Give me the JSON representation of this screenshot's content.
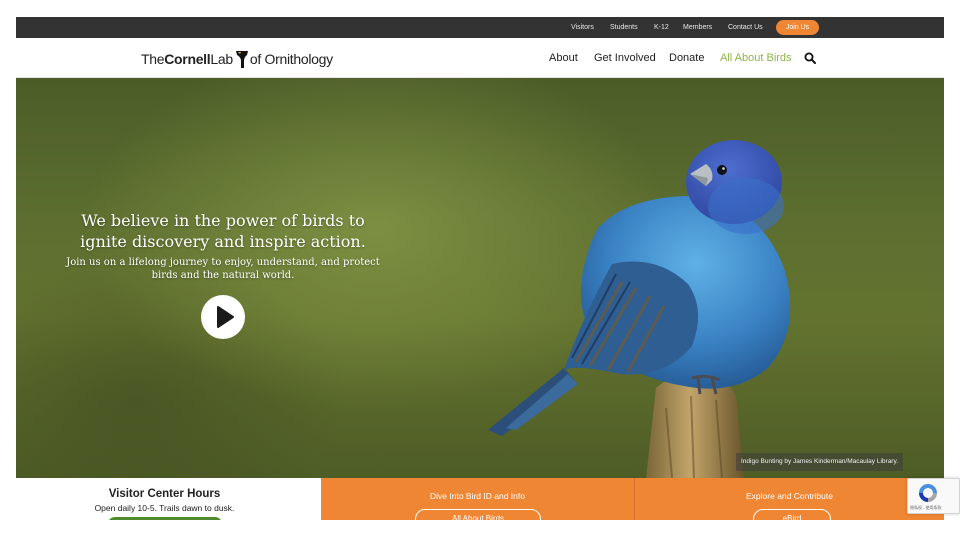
{
  "utility_bar": {
    "links": [
      "Visitors",
      "Students",
      "K-12",
      "Members",
      "Contact Us"
    ],
    "join_label": "Join Us"
  },
  "logo": {
    "the": "The",
    "cornell": "Cornell",
    "lab": "Lab",
    "ornithology": "of Ornithology"
  },
  "nav": {
    "items": [
      "About",
      "Get Involved",
      "Donate",
      "All About Birds"
    ],
    "active_item": "All About Birds",
    "search_icon": "search-icon"
  },
  "hero": {
    "heading": "We believe in the power of birds to ignite discovery and inspire action.",
    "subheading": "Join us on a lifelong journey to enjoy, understand, and protect birds and the natural world.",
    "play_icon": "play-icon",
    "photo_credit": "Indigo Bunting by James Kinderman/Macaulay Library."
  },
  "panels": {
    "visitor": {
      "title": "Visitor Center Hours",
      "hours": "Open daily 10-5. Trails dawn to dusk."
    },
    "bird": {
      "title": "Dive Into Bird ID and Info",
      "button_label": "All About Birds"
    },
    "explore": {
      "title": "Explore and Contribute",
      "button_label": "eBird"
    }
  },
  "recaptcha": {
    "text": "隐私权 - 使用条款"
  },
  "colors": {
    "utility_bar": "#333333",
    "accent_orange": "#ef8633",
    "nav_active_green": "#8db54a",
    "visitor_button_green": "#4f8a2e",
    "bird_blue": "#3a82c4"
  }
}
